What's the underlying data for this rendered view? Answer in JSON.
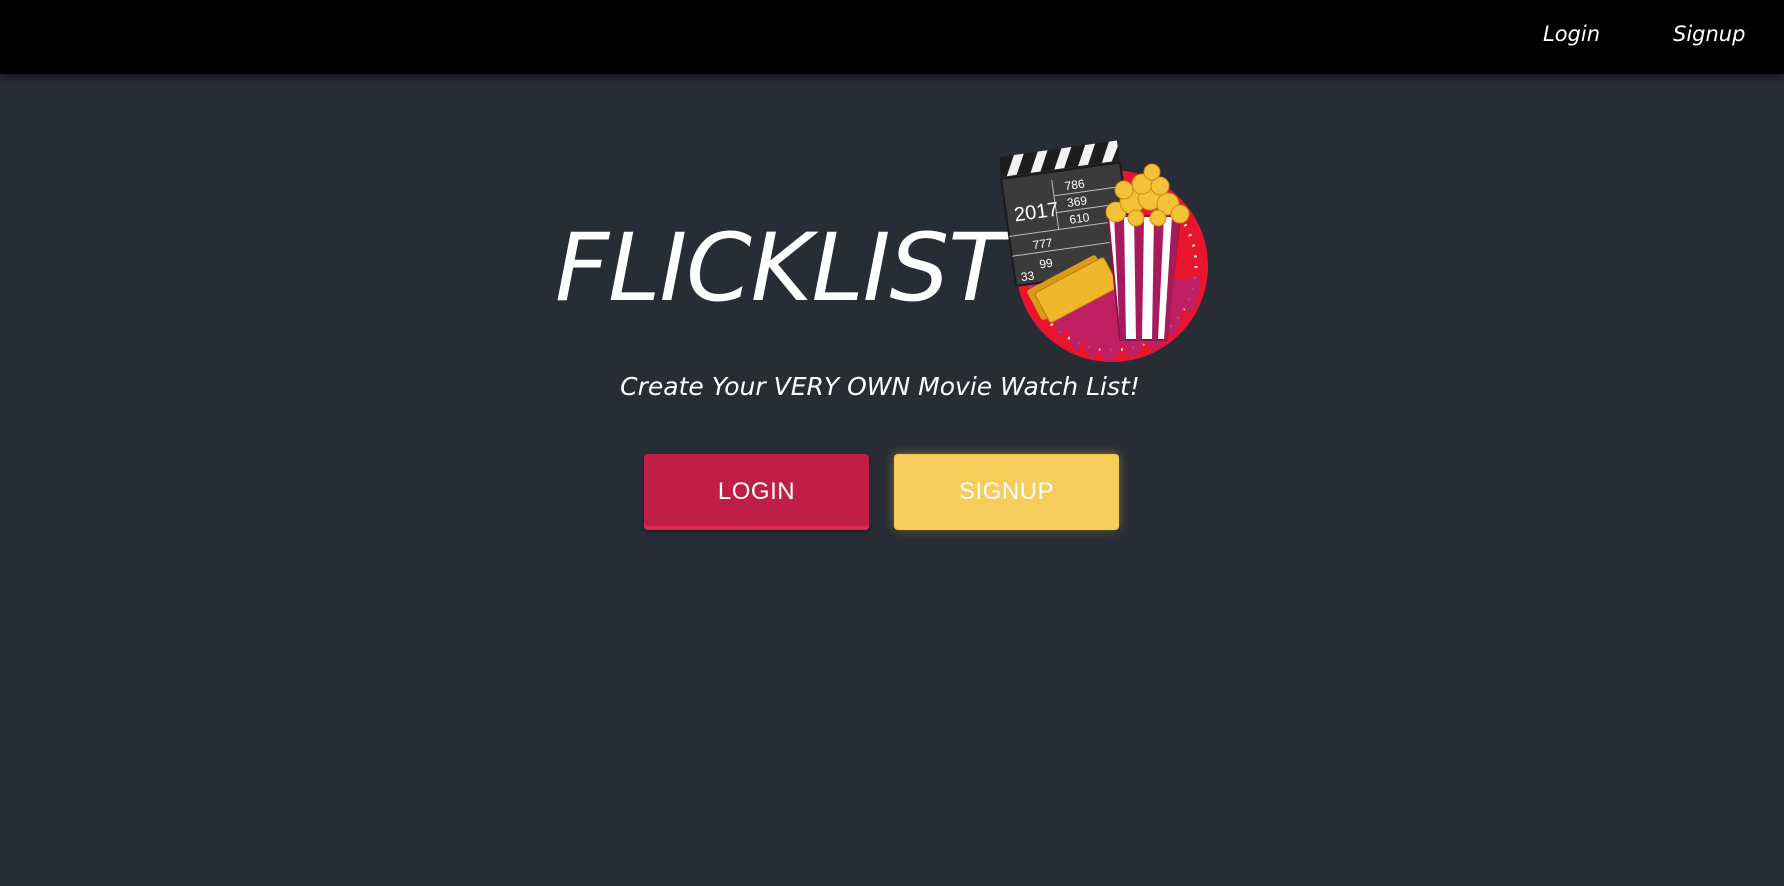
{
  "navbar": {
    "login_label": "Login",
    "signup_label": "Signup"
  },
  "hero": {
    "title": "FLICKLIST",
    "tagline": "Create Your VERY OWN Movie Watch List!",
    "login_button": "LOGIN",
    "signup_button": "SIGNUP"
  },
  "logo": {
    "icon": "movie-clapperboard-popcorn-logo",
    "clapper_year": "2017",
    "clapper_numbers": [
      "786",
      "369",
      "610",
      "777",
      "99",
      "33"
    ]
  },
  "colors": {
    "background": "#282c35",
    "navbar": "#000000",
    "login_button": "#bf1f47",
    "signup_button": "#f6cd5a",
    "text": "#ffffff"
  }
}
